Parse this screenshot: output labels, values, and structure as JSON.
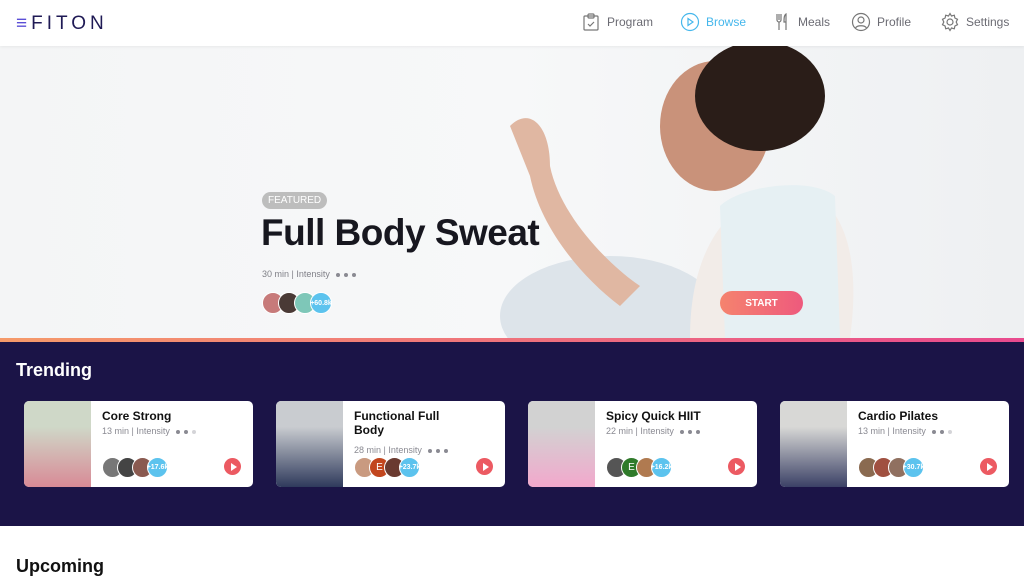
{
  "app": {
    "logo": "FITON"
  },
  "nav": [
    {
      "label": "Program",
      "icon": "clipboard-icon"
    },
    {
      "label": "Browse",
      "icon": "play-circle-icon",
      "active": true
    },
    {
      "label": "Meals",
      "icon": "utensils-icon"
    },
    {
      "label": "Profile",
      "icon": "user-icon"
    },
    {
      "label": "Settings",
      "icon": "gear-icon"
    }
  ],
  "featured": {
    "badge": "FEATURED",
    "title": "Full Body Sweat",
    "duration": "30 min",
    "intensity_label": "Intensity",
    "intensity": 3,
    "participants": "+60.8k",
    "start": "START"
  },
  "trending": {
    "heading": "Trending",
    "cards": [
      {
        "title": "Core Strong",
        "duration": "13 min",
        "intensity_label": "Intensity",
        "intensity": 2,
        "participants": "+17.6k"
      },
      {
        "title": "Functional Full Body",
        "duration": "28 min",
        "intensity_label": "Intensity",
        "intensity": 3,
        "participants": "+23.7k",
        "avatar_letter": "E"
      },
      {
        "title": "Spicy Quick HIIT",
        "duration": "22 min",
        "intensity_label": "Intensity",
        "intensity": 3,
        "participants": "+16.2k",
        "avatar_letter": "E"
      },
      {
        "title": "Cardio Pilates",
        "duration": "13 min",
        "intensity_label": "Intensity",
        "intensity": 2,
        "participants": "+30.7k"
      }
    ]
  },
  "upcoming": {
    "heading": "Upcoming"
  },
  "colors": {
    "brand": "#1f1a55",
    "active": "#45b7ec",
    "trending_bg": "#1b1447",
    "start": "#ee5a7d",
    "play": "#ec5a62"
  }
}
